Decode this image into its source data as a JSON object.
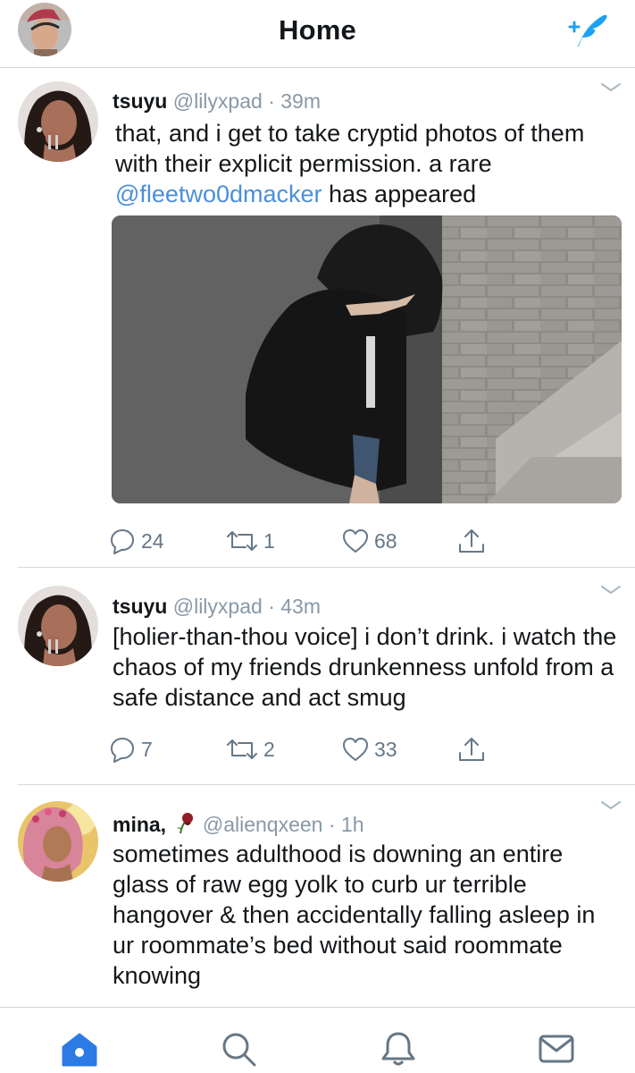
{
  "header": {
    "title": "Home",
    "profile_icon": "user-avatar",
    "compose_icon": "compose-feather-icon",
    "accent_color": "#1da1f2"
  },
  "tweets": [
    {
      "name": "tsuyu",
      "handle": "@lilyxpad",
      "separator": "·",
      "time": "39m",
      "text_before": "that, and i get to take cryptid photos of them with their explicit permission. a rare ",
      "mention": "@fleetwo0dmacker",
      "text_after": " has appeared",
      "replies": "24",
      "retweets": "1",
      "likes": "68"
    },
    {
      "name": "tsuyu",
      "handle": "@lilyxpad",
      "separator": "·",
      "time": "43m",
      "text": "[holier-than-thou voice] i don’t drink. i watch the chaos of my friends drunkenness unfold from a safe distance and act smug",
      "replies": "7",
      "retweets": "2",
      "likes": "33"
    },
    {
      "name": "mina,",
      "handle": "@alienqxeen",
      "separator": "·",
      "time": "1h",
      "text": "sometimes adulthood is downing an entire glass of raw egg yolk to curb ur terrible hangover & then accidentally falling asleep in ur roommate’s bed without said roommate knowing"
    }
  ],
  "tabbar": {
    "items": [
      "home-icon",
      "search-icon",
      "notifications-bell-icon",
      "messages-envelope-icon"
    ],
    "active": "home-icon"
  }
}
